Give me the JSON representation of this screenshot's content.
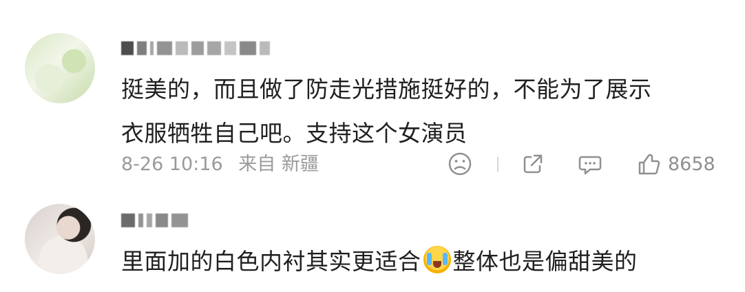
{
  "comments": [
    {
      "text": "挺美的，而且做了防走光措施挺好的，不能为了展示衣服牺牲自己吧。支持这个女演员",
      "text_line1": "挺美的，而且做了防走光措施挺好的，不能为了展示",
      "text_line2": "衣服牺牲自己吧。支持这个女演员",
      "date": "8-26 10:16",
      "location": "来自 新疆",
      "likes": "8658"
    },
    {
      "text_part1": "里面加的白色内衬其实更适合",
      "text_part2": "整体也是偏甜美的"
    }
  ],
  "icons": {
    "reaction": "sad-face-icon",
    "share": "share-icon",
    "reply": "comment-icon",
    "like": "thumbs-up-icon",
    "emoji": "crying-laughing-emoji"
  },
  "colors": {
    "text": "#1f1f1f",
    "meta": "#9a9a9a",
    "icon": "#8f8f8f"
  }
}
